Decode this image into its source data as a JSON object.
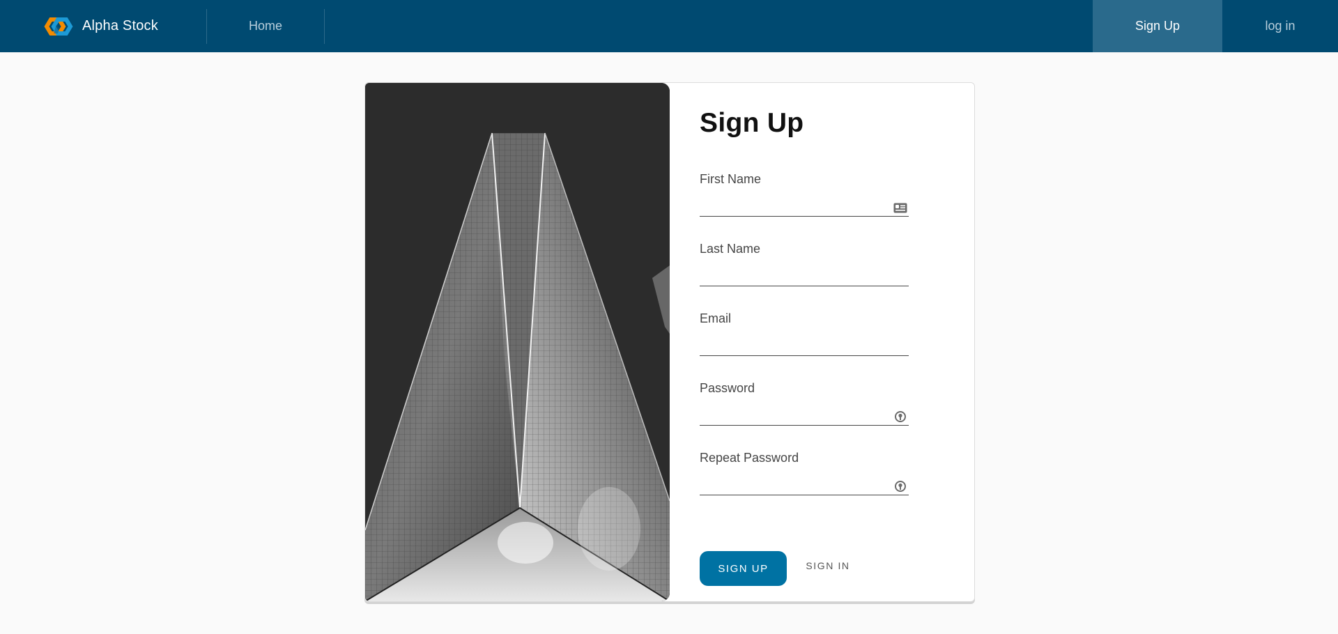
{
  "header": {
    "brand": "Alpha Stock",
    "nav": {
      "home": "Home",
      "signup": "Sign Up",
      "login": "log in"
    }
  },
  "form": {
    "title": "Sign Up",
    "fields": [
      {
        "label": "First Name",
        "value": "",
        "icon": "id-card-icon"
      },
      {
        "label": "Last Name",
        "value": ""
      },
      {
        "label": "Email",
        "value": ""
      },
      {
        "label": "Password",
        "value": "",
        "icon": "password-manager-key-icon"
      },
      {
        "label": "Repeat Password",
        "value": "",
        "icon": "password-manager-key-icon"
      }
    ],
    "buttons": {
      "primary": "SIGN UP",
      "secondary": "SIGN IN"
    }
  },
  "colors": {
    "header_bg": "#004a71",
    "nav_active_bg": "#2a6a8c",
    "primary_button": "#0072a3",
    "logo_orange": "#f38b00",
    "logo_blue": "#1d9ad6"
  }
}
